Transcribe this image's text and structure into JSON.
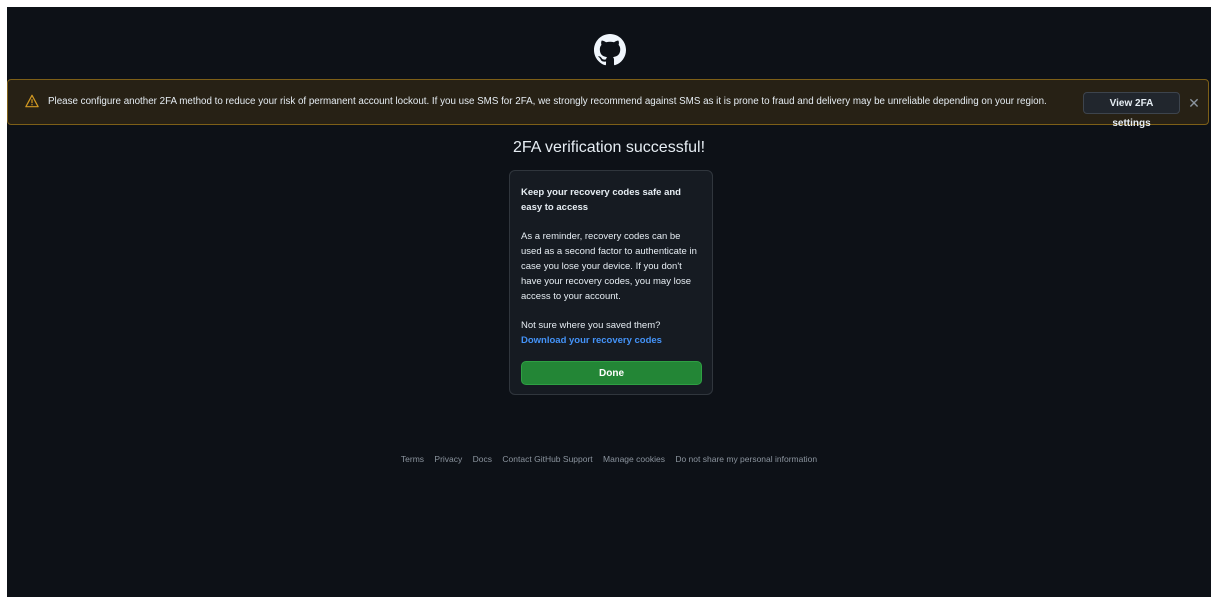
{
  "logo": {
    "icon": "github-mark-icon"
  },
  "banner": {
    "icon": "alert-triangle-icon",
    "icon_color": "#d29922",
    "message": "Please configure another 2FA method to reduce your risk of permanent account lockout. If you use SMS for 2FA, we strongly recommend against SMS as it is prone to fraud and delivery may be unreliable depending on your region.",
    "settings_button_label": "View 2FA settings",
    "close_icon": "close-icon"
  },
  "main": {
    "title": "2FA verification successful!",
    "card": {
      "heading": "Keep your recovery codes safe and easy to access",
      "body": "As a reminder, recovery codes can be used as a second factor to authenticate in case you lose your device. If you don't have your recovery codes, you may lose access to your account.",
      "question": "Not sure where you saved them?",
      "link_label": "Download your recovery codes",
      "done_label": "Done"
    }
  },
  "footer": {
    "links": [
      "Terms",
      "Privacy",
      "Docs",
      "Contact GitHub Support",
      "Manage cookies",
      "Do not share my personal information"
    ]
  },
  "colors": {
    "background": "#0d1117",
    "card": "#161b22",
    "accent_link": "#4493f8",
    "primary_button": "#238636",
    "banner_bg": "#272115",
    "banner_border": "#7d5f17"
  }
}
